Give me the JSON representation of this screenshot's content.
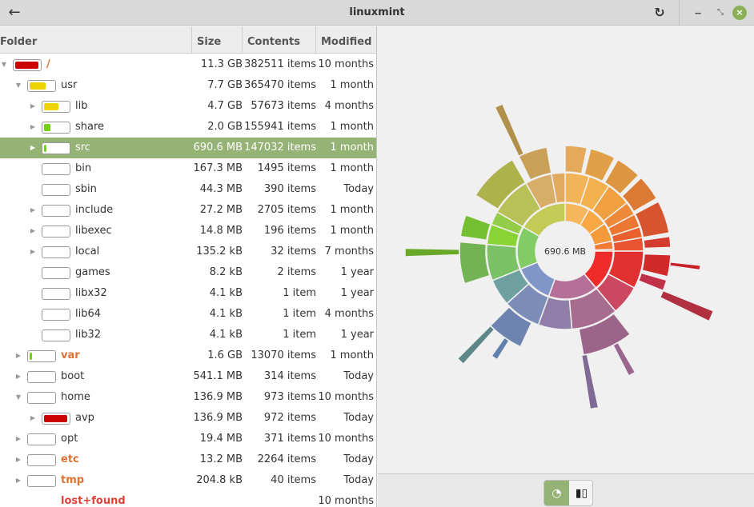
{
  "window": {
    "title": "linuxmint",
    "back_icon": "←",
    "reload_icon": "↻",
    "minimize_icon": "‒",
    "maximize_icon": "⤡",
    "close_icon": "×"
  },
  "table": {
    "columns": [
      "Folder",
      "Size",
      "Contents",
      "Modified"
    ],
    "rows": [
      {
        "name": "/",
        "size": "11.3 GB",
        "contents": "382511 items",
        "modified": "10 months",
        "depth": 0,
        "expander": "open",
        "fill": 0.95,
        "fill_color": "#cc0000",
        "style": "warn"
      },
      {
        "name": "usr",
        "size": "7.7 GB",
        "contents": "365470 items",
        "modified": "1 month",
        "depth": 1,
        "expander": "open",
        "fill": 0.68,
        "fill_color": "#edd400",
        "style": ""
      },
      {
        "name": "lib",
        "size": "4.7 GB",
        "contents": "57673 items",
        "modified": "4 months",
        "depth": 2,
        "expander": "closed",
        "fill": 0.61,
        "fill_color": "#edd400",
        "style": ""
      },
      {
        "name": "share",
        "size": "2.0 GB",
        "contents": "155941 items",
        "modified": "1 month",
        "depth": 2,
        "expander": "closed",
        "fill": 0.26,
        "fill_color": "#73d216",
        "style": ""
      },
      {
        "name": "src",
        "size": "690.6 MB",
        "contents": "147032 items",
        "modified": "1 month",
        "depth": 2,
        "expander": "closed",
        "fill": 0.09,
        "fill_color": "#73d216",
        "style": "",
        "selected": true
      },
      {
        "name": "bin",
        "size": "167.3 MB",
        "contents": "1495 items",
        "modified": "1 month",
        "depth": 2,
        "expander": "none",
        "fill": 0.0,
        "fill_color": "#73d216",
        "style": ""
      },
      {
        "name": "sbin",
        "size": "44.3 MB",
        "contents": "390 items",
        "modified": "Today",
        "depth": 2,
        "expander": "none",
        "fill": 0.0,
        "fill_color": "#73d216",
        "style": ""
      },
      {
        "name": "include",
        "size": "27.2 MB",
        "contents": "2705 items",
        "modified": "1 month",
        "depth": 2,
        "expander": "closed",
        "fill": 0.0,
        "fill_color": "#73d216",
        "style": ""
      },
      {
        "name": "libexec",
        "size": "14.8 MB",
        "contents": "196 items",
        "modified": "1 month",
        "depth": 2,
        "expander": "closed",
        "fill": 0.0,
        "fill_color": "#73d216",
        "style": ""
      },
      {
        "name": "local",
        "size": "135.2 kB",
        "contents": "32 items",
        "modified": "7 months",
        "depth": 2,
        "expander": "closed",
        "fill": 0.0,
        "fill_color": "#73d216",
        "style": ""
      },
      {
        "name": "games",
        "size": "8.2 kB",
        "contents": "2 items",
        "modified": "1 year",
        "depth": 2,
        "expander": "none",
        "fill": 0.0,
        "fill_color": "#73d216",
        "style": ""
      },
      {
        "name": "libx32",
        "size": "4.1 kB",
        "contents": "1 item",
        "modified": "1 year",
        "depth": 2,
        "expander": "none",
        "fill": 0.0,
        "fill_color": "#73d216",
        "style": ""
      },
      {
        "name": "lib64",
        "size": "4.1 kB",
        "contents": "1 item",
        "modified": "4 months",
        "depth": 2,
        "expander": "none",
        "fill": 0.0,
        "fill_color": "#73d216",
        "style": ""
      },
      {
        "name": "lib32",
        "size": "4.1 kB",
        "contents": "1 item",
        "modified": "1 year",
        "depth": 2,
        "expander": "none",
        "fill": 0.0,
        "fill_color": "#73d216",
        "style": ""
      },
      {
        "name": "var",
        "size": "1.6 GB",
        "contents": "13070 items",
        "modified": "1 month",
        "depth": 1,
        "expander": "closed",
        "fill": 0.04,
        "fill_color": "#73d216",
        "style": "warn"
      },
      {
        "name": "boot",
        "size": "541.1 MB",
        "contents": "314 items",
        "modified": "Today",
        "depth": 1,
        "expander": "closed",
        "fill": 0.0,
        "fill_color": "#73d216",
        "style": ""
      },
      {
        "name": "home",
        "size": "136.9 MB",
        "contents": "973 items",
        "modified": "10 months",
        "depth": 1,
        "expander": "open",
        "fill": 0.0,
        "fill_color": "#73d216",
        "style": ""
      },
      {
        "name": "avp",
        "size": "136.9 MB",
        "contents": "972 items",
        "modified": "Today",
        "depth": 2,
        "expander": "closed",
        "fill": 0.95,
        "fill_color": "#cc0000",
        "style": ""
      },
      {
        "name": "opt",
        "size": "19.4 MB",
        "contents": "371 items",
        "modified": "10 months",
        "depth": 1,
        "expander": "closed",
        "fill": 0.0,
        "fill_color": "#73d216",
        "style": ""
      },
      {
        "name": "etc",
        "size": "13.2 MB",
        "contents": "2264 items",
        "modified": "Today",
        "depth": 1,
        "expander": "closed",
        "fill": 0.0,
        "fill_color": "#73d216",
        "style": "warn"
      },
      {
        "name": "tmp",
        "size": "204.8 kB",
        "contents": "40 items",
        "modified": "Today",
        "depth": 1,
        "expander": "closed",
        "fill": 0.0,
        "fill_color": "#73d216",
        "style": "warn"
      },
      {
        "name": "lost+found",
        "size": "",
        "contents": "",
        "modified": "10 months",
        "depth": 1,
        "expander": "none",
        "fill": null,
        "fill_color": "",
        "style": "err"
      }
    ]
  },
  "chart": {
    "center_label": "690.6 MB",
    "type": "sunburst"
  },
  "view_toggle": {
    "rings_icon": "◔",
    "treemap_icon": "▮▯"
  }
}
